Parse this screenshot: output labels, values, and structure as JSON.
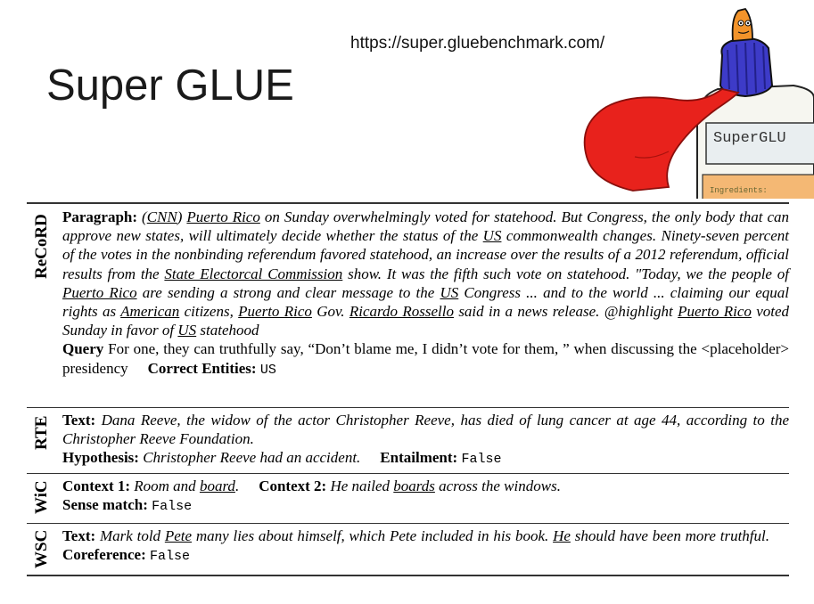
{
  "title": "Super GLUE",
  "url": "https://super.gluebenchmark.com/",
  "mascot": {
    "bottle_label": "SuperGLU",
    "ingredients_label": "Ingredients:"
  },
  "record": {
    "side_label": "ReCoRD",
    "paragraph_label": "Paragraph:",
    "p": [
      "(",
      "CNN",
      ") ",
      "Puerto Rico",
      " on Sunday overwhelmingly voted for statehood. But Congress, the only body that can approve new states, will ultimately decide whether the status of the ",
      "US",
      " commonwealth changes. Ninety-seven percent of the votes in the nonbinding referendum favored statehood, an increase over the results of a 2012 referendum, official results from the ",
      "State Electorcal Commission",
      " show. It was the fifth such vote on statehood. \"Today, we the people of ",
      "Puerto Rico",
      " are sending a strong and clear message to the ",
      "US",
      " Congress ... and to the world ... claiming our equal rights as ",
      "American",
      " citizens, ",
      "Puerto Rico",
      " Gov. ",
      "Ricardo Rossello",
      " said in a news release. @highlight ",
      "Puerto Rico",
      " voted Sunday in favor of ",
      "US",
      " statehood"
    ],
    "query_label": "Query",
    "query_text": " For one, they can truthfully say, “Don’t blame me, I didn’t vote for them, ” when discussing the <placeholder> presidency",
    "entities_label": "Correct Entities:",
    "entities_value": "US"
  },
  "rte": {
    "side_label": "RTE",
    "text_label": "Text:",
    "text_value": "Dana Reeve, the widow of the actor Christopher Reeve, has died of lung cancer at age 44, according to the Christopher Reeve Foundation.",
    "hyp_label": "Hypothesis:",
    "hyp_value": "Christopher Reeve had an accident.",
    "entail_label": "Entailment:",
    "entail_value": "False"
  },
  "wic": {
    "side_label": "WiC",
    "c1_label": "Context 1:",
    "c1_a": "Room and ",
    "c1_u": "board",
    "c1_b": ".",
    "c2_label": "Context 2:",
    "c2_a": "He nailed ",
    "c2_u": "boards",
    "c2_b": " across the windows.",
    "sense_label": "Sense match:",
    "sense_value": "False"
  },
  "wsc": {
    "side_label": "WSC",
    "text_label": "Text:",
    "t_a": "Mark told ",
    "t_u1": "Pete",
    "t_b": " many lies about himself, which Pete included in his book. ",
    "t_u2": "He",
    "t_c": " should have been more truthful.",
    "coref_label": "Coreference:",
    "coref_value": "False"
  }
}
